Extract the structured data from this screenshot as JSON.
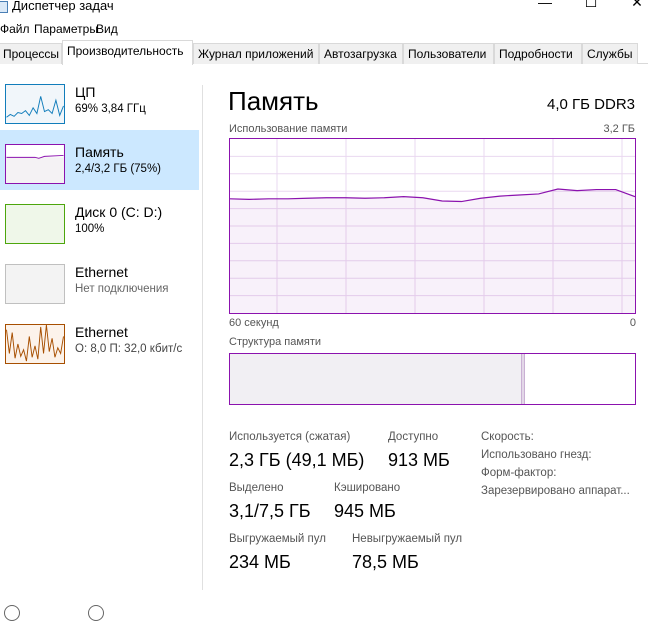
{
  "window": {
    "title": "Диспетчер задач",
    "minimize": "—",
    "maximize": "☐",
    "close": "✕"
  },
  "menu": [
    "Файл",
    "Параметры",
    "Вид"
  ],
  "tabs": [
    "Процессы",
    "Производительность",
    "Журнал приложений",
    "Автозагрузка",
    "Пользователи",
    "Подробности",
    "Службы"
  ],
  "active_tab": "Производительность",
  "sidebar": [
    {
      "name": "ЦП",
      "sub": "69%  3,84 ГГц",
      "color": "#117dbb"
    },
    {
      "name": "Память",
      "sub": "2,4/3,2 ГБ (75%)",
      "color": "#8b12ae",
      "selected": true
    },
    {
      "name": "Диск 0 (C: D:)",
      "sub": "100%",
      "color": "#4da60c"
    },
    {
      "name": "Ethernet",
      "sub": "Нет подключения",
      "color": "#a0a0a0"
    },
    {
      "name": "Ethernet",
      "sub": "О: 8,0  П: 32,0 кбит/с",
      "color": "#a74f01"
    }
  ],
  "main": {
    "title": "Память",
    "spec": "4,0 ГБ DDR3",
    "chart_label": "Использование памяти",
    "chart_max": "3,2 ГБ",
    "time_left": "60 секунд",
    "time_right": "0",
    "composition_label": "Структура памяти",
    "composition": {
      "in_use_fraction": 0.72,
      "modified_fraction": 0.01
    }
  },
  "chart_data": {
    "type": "area",
    "ylim": [
      0,
      3.2
    ],
    "xlim": [
      60,
      0
    ],
    "grid": true,
    "y": [
      2.1,
      2.09,
      2.1,
      2.1,
      2.11,
      2.12,
      2.12,
      2.11,
      2.12,
      2.14,
      2.12,
      2.06,
      2.05,
      2.11,
      2.15,
      2.17,
      2.19,
      2.28,
      2.25,
      2.27,
      2.27,
      2.14
    ]
  },
  "stats": {
    "in_use_label": "Используется (сжатая)",
    "in_use": "2,3 ГБ (49,1 МБ)",
    "available_label": "Доступно",
    "available": "913 МБ",
    "committed_label": "Выделено",
    "committed": "3,1/7,5 ГБ",
    "cached_label": "Кэшировано",
    "cached": "945 МБ",
    "paged_label": "Выгружаемый пул",
    "paged": "234 МБ",
    "nonpaged_label": "Невыгружаемый пул",
    "nonpaged": "78,5 МБ",
    "speed_label": "Скорость:",
    "slots_label": "Использовано гнезд:",
    "form_label": "Форм-фактор:",
    "reserved_label": "Зарезервировано аппарат..."
  },
  "colors": {
    "memory": "#8b12ae",
    "selected_bg": "#cce8ff"
  }
}
